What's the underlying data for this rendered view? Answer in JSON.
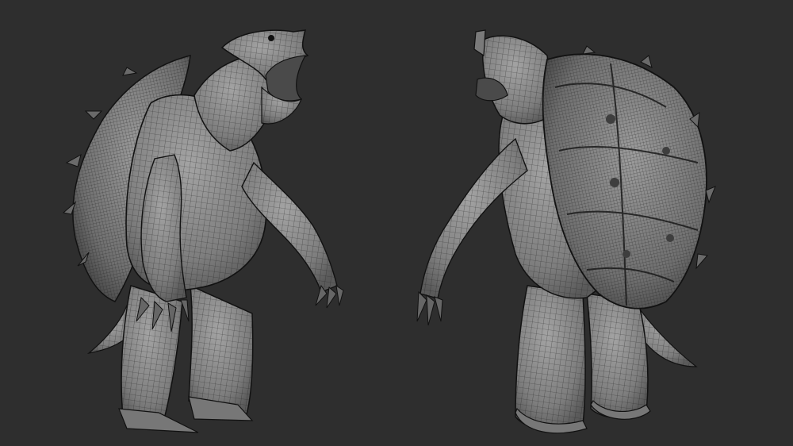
{
  "scene": {
    "background": "#2e2e2e",
    "mesh_fill": "#8a8a8a",
    "mesh_dark": "#4a4a4a",
    "wire": "#222222",
    "outline": "#111111",
    "views": [
      "front-three-quarter",
      "back-three-quarter"
    ]
  }
}
